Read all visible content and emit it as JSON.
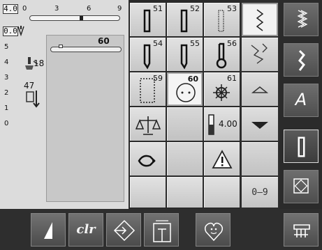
{
  "info_panel": {
    "stitch_width": "4.0",
    "stitch_length": "0.0",
    "width_scale_ticks": [
      "0",
      "3",
      "6",
      "9"
    ],
    "length_scale_ticks": [
      "5",
      "4",
      "3",
      "2",
      "1",
      "0"
    ],
    "presser_foot_pressure": "18",
    "thread_tension": "47",
    "preview_stitch_number": "60"
  },
  "stitch_grid": {
    "stitches": [
      {
        "number": "51",
        "icon": "buttonhole-standard-icon"
      },
      {
        "number": "52",
        "icon": "buttonhole-stretch-icon"
      },
      {
        "number": "53",
        "icon": "buttonhole-heirloom-icon"
      },
      {
        "number": "54",
        "icon": "buttonhole-round-icon"
      },
      {
        "number": "55",
        "icon": "buttonhole-round-bartack-icon"
      },
      {
        "number": "56",
        "icon": "buttonhole-keyhole-icon"
      },
      {
        "number": "59",
        "icon": "buttonhole-straight-stitch-icon"
      },
      {
        "number": "60",
        "icon": "button-sew-on-icon"
      },
      {
        "number": "61",
        "icon": "eyelet-icon"
      }
    ],
    "selected_stitch": "60",
    "settings": {
      "balance_icon": "balance-icon",
      "buttonhole_length_value": "4.00",
      "manual_buttonhole_icon": "manual-buttonhole-icon",
      "warning_icon": "warning-icon",
      "numeric_input_label": "0–9"
    }
  },
  "scroll_column": {
    "zigzag_icon": "zigzag-icon",
    "tacking_icon": "tacking-icon",
    "scroll_up_icon": "scroll-up-icon",
    "scroll_down_icon": "scroll-down-icon"
  },
  "category_menu": {
    "items": [
      {
        "id": "practical",
        "icon": "practical-stitches-icon"
      },
      {
        "id": "decorative",
        "icon": "decorative-stitches-icon"
      },
      {
        "id": "alphabets",
        "label": "A"
      },
      {
        "id": "buttonholes",
        "icon": "buttonholes-icon",
        "selected": true
      },
      {
        "id": "quilt",
        "icon": "quilt-stitches-icon"
      }
    ]
  },
  "bottom_bar": {
    "clear_label": "clr",
    "buttons": [
      "needle-stop-icon",
      "clear-button",
      "pattern-start-icon",
      "memory-icon",
      "personal-program-icon",
      "setup-icon"
    ]
  }
}
